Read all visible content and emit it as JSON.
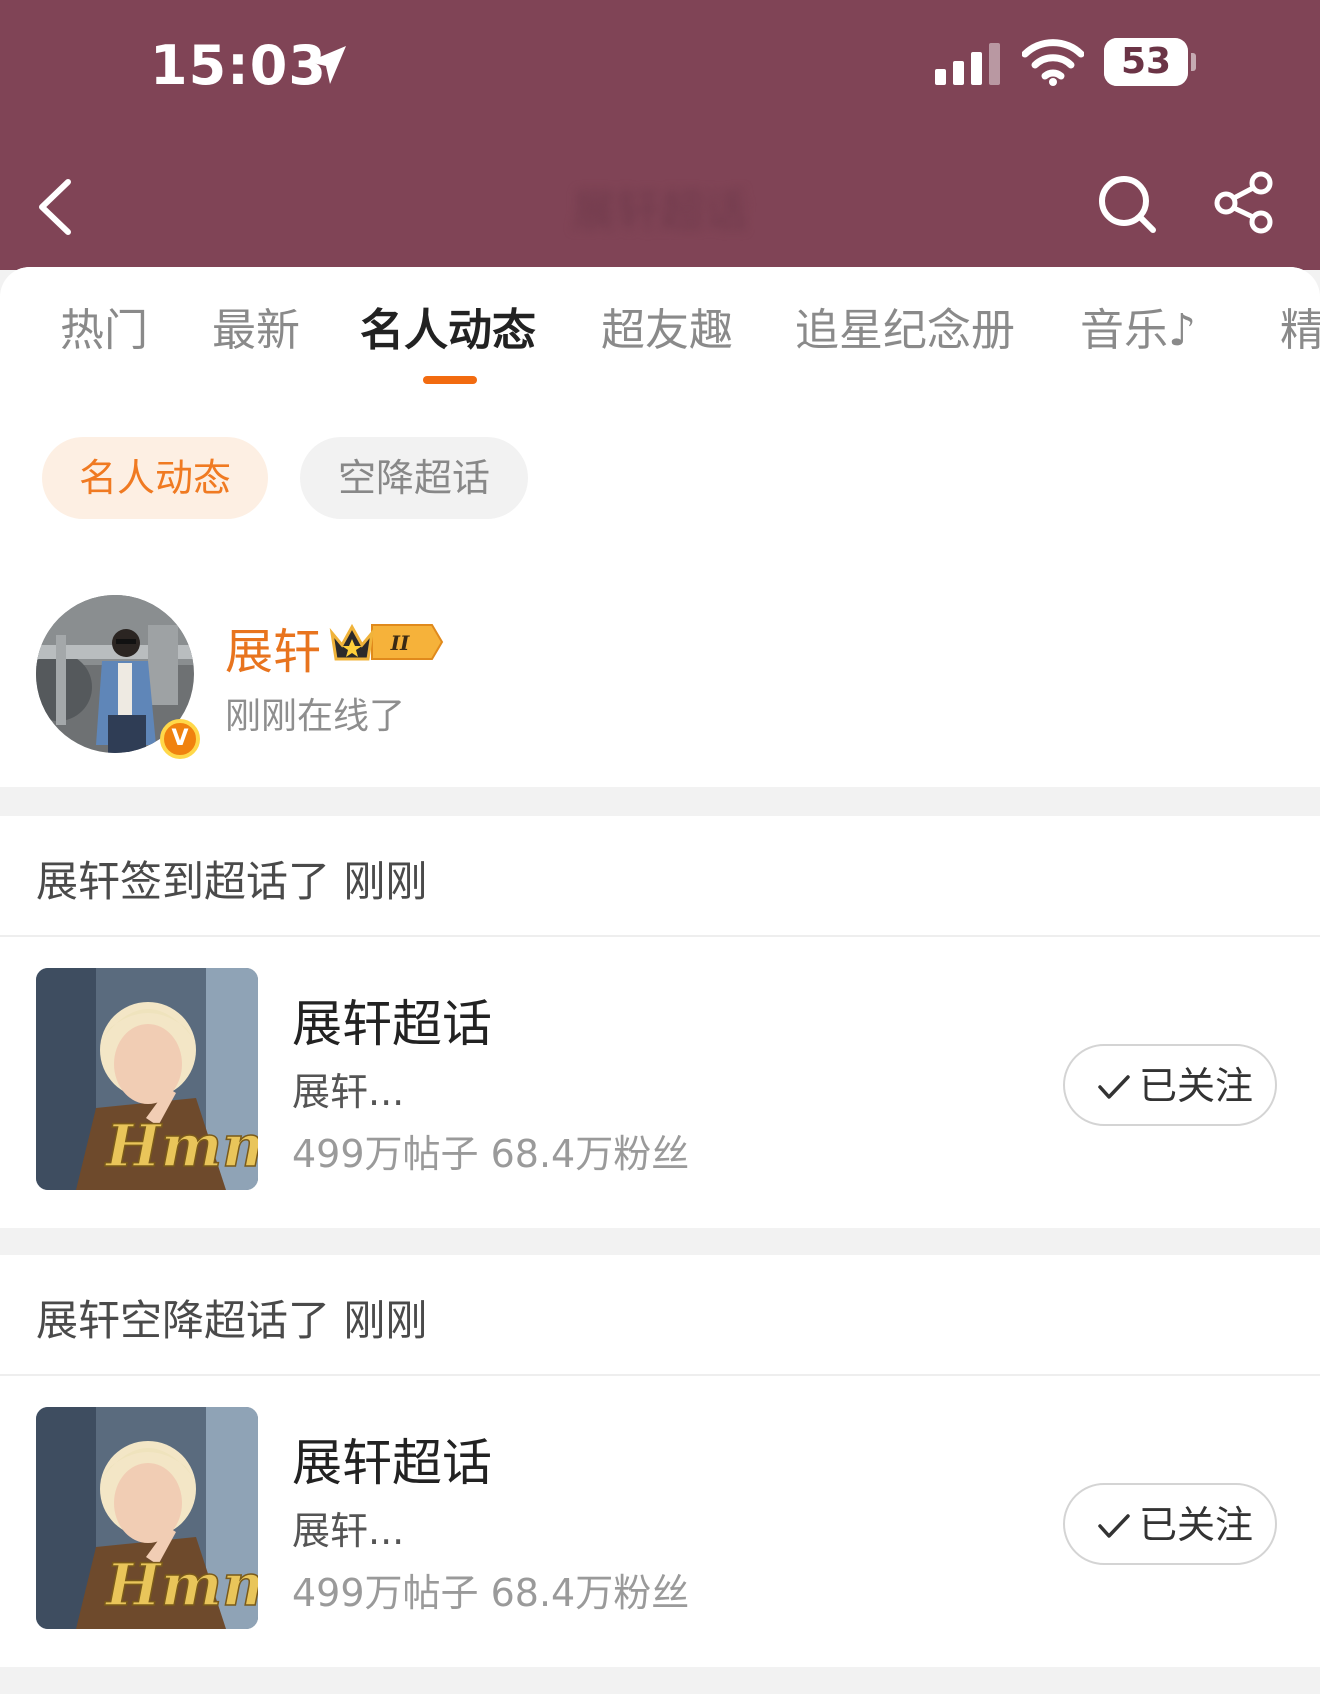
{
  "status_bar": {
    "time": "15:03",
    "battery_level": "53",
    "battery_fraction": 0.53
  },
  "nav": {
    "title": "展轩超话"
  },
  "tabs": [
    {
      "label": "热门",
      "active": false
    },
    {
      "label": "最新",
      "active": false
    },
    {
      "label": "名人动态",
      "active": true
    },
    {
      "label": "超友趣",
      "active": false
    },
    {
      "label": "追星纪念册",
      "active": false
    },
    {
      "label": "音乐♪",
      "active": false
    },
    {
      "label": "精",
      "active": false
    }
  ],
  "filters": {
    "active": "名人动态",
    "inactive": "空降超话"
  },
  "celebrity": {
    "name": "展轩",
    "level_badge": "II",
    "verified_mark": "V",
    "status": "刚刚在线了"
  },
  "activities": [
    {
      "event": "展轩签到超话了 刚刚",
      "topic_title": "展轩超话",
      "topic_desc": "展轩...",
      "topic_stats": "499万帖子  68.4万粉丝",
      "image_text": "Hmm",
      "follow_label": "已关注"
    },
    {
      "event": "展轩空降超话了 刚刚",
      "topic_title": "展轩超话",
      "topic_desc": "展轩...",
      "topic_stats": "499万帖子  68.4万粉丝",
      "image_text": "Hmm",
      "follow_label": "已关注"
    }
  ],
  "colors": {
    "header_bg": "#804456",
    "accent_orange": "#f26b10",
    "chip_active_bg": "#fdefe3",
    "chip_active_text": "#f07a22",
    "name_orange": "#e8741e"
  }
}
